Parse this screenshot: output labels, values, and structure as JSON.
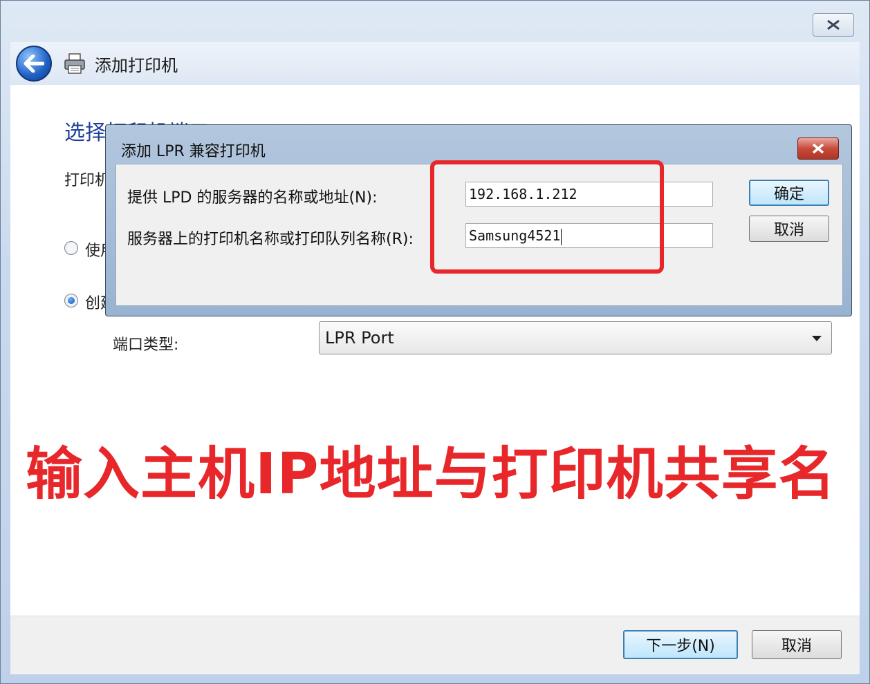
{
  "wizard": {
    "title": "添加打印机",
    "heading": "选择打印机端口",
    "printer_label": "打印机",
    "radio_use": "使用",
    "radio_create": "创建",
    "port_type_label": "端口类型:",
    "port_type_value": "LPR Port",
    "next_button": "下一步(N)",
    "cancel_button": "取消"
  },
  "dialog": {
    "title": "添加 LPR 兼容打印机",
    "server_label": "提供 LPD 的服务器的名称或地址(N):",
    "server_value": "192.168.1.212",
    "queue_label": "服务器上的打印机名称或打印队列名称(R):",
    "queue_value": "Samsung4521",
    "ok_button": "确定",
    "cancel_button": "取消"
  },
  "annotation": "输入主机IP地址与打印机共享名",
  "colors": {
    "highlight": "#e8272a",
    "heading": "#1e3f9a"
  }
}
